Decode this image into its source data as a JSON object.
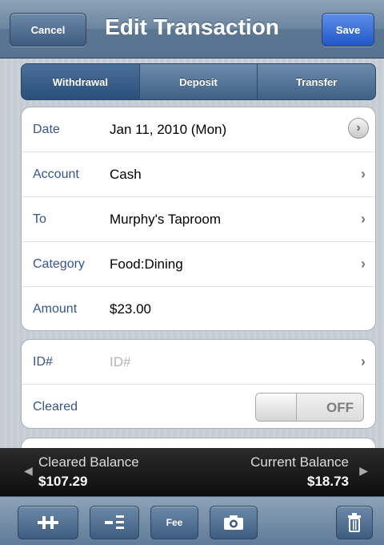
{
  "navbar": {
    "title": "Edit Transaction",
    "cancel_label": "Cancel",
    "save_label": "Save"
  },
  "segments": [
    {
      "label": "Withdrawal",
      "active": true
    },
    {
      "label": "Deposit",
      "active": false
    },
    {
      "label": "Transfer",
      "active": false
    }
  ],
  "fields": {
    "date": {
      "label": "Date",
      "value": "Jan 11, 2010 (Mon)"
    },
    "account": {
      "label": "Account",
      "value": "Cash"
    },
    "to": {
      "label": "To",
      "value": "Murphy's Taproom"
    },
    "category": {
      "label": "Category",
      "value": "Food:Dining"
    },
    "amount": {
      "label": "Amount",
      "value": "$23.00"
    },
    "id": {
      "label": "ID#",
      "placeholder": "ID#"
    },
    "cleared": {
      "label": "Cleared",
      "toggle": "OFF"
    }
  },
  "balances": {
    "cleared_label": "Cleared Balance",
    "cleared_value": "$107.29",
    "current_label": "Current Balance",
    "current_value": "$18.73"
  },
  "toolbar": {
    "fee_label": "Fee"
  },
  "icons": [
    "chevron-right-icon",
    "split-icon",
    "itemize-icon",
    "camera-icon",
    "trash-icon",
    "left-arrow-icon",
    "right-arrow-icon"
  ],
  "colors": {
    "label_blue": "#385487",
    "save_blue": "#2257c9",
    "nav_blue": "#6b85a0"
  }
}
